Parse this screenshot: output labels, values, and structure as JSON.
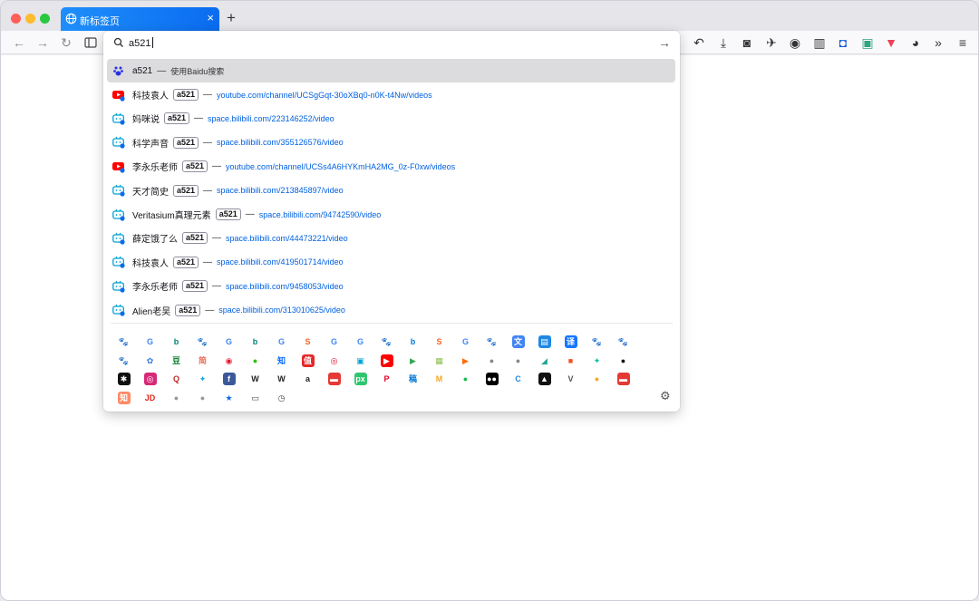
{
  "tab": {
    "title": "新标签页",
    "close": "×",
    "new_tab": "+"
  },
  "nav": {
    "back": "←",
    "forward": "→",
    "reload": "↻"
  },
  "urlbar": {
    "value": "a521",
    "go": "→"
  },
  "results": [
    {
      "icon": "baidu-icon",
      "title": "a521",
      "hint": "使用Baidu搜索",
      "selected": true
    },
    {
      "icon": "youtube-icon",
      "title": "科技袁人",
      "keyword": "a521",
      "url": "youtube.com/channel/UCSgGqt-30oXBq0-n0K-t4Nw/videos"
    },
    {
      "icon": "bilibili-icon",
      "title": "妈咪说",
      "keyword": "a521",
      "url": "space.bilibili.com/223146252/video"
    },
    {
      "icon": "bilibili-icon",
      "title": "科学声音",
      "keyword": "a521",
      "url": "space.bilibili.com/355126576/video"
    },
    {
      "icon": "youtube-icon",
      "title": "李永乐老师",
      "keyword": "a521",
      "url": "youtube.com/channel/UCSs4A6HYKmHA2MG_0z-F0xw/videos"
    },
    {
      "icon": "bilibili-icon",
      "title": "天才简史",
      "keyword": "a521",
      "url": "space.bilibili.com/213845897/video"
    },
    {
      "icon": "bilibili-icon",
      "title": "Veritasium真理元素",
      "keyword": "a521",
      "url": "space.bilibili.com/94742590/video"
    },
    {
      "icon": "bilibili-icon",
      "title": "薛定饿了么",
      "keyword": "a521",
      "url": "space.bilibili.com/44473221/video"
    },
    {
      "icon": "bilibili-icon",
      "title": "科技袁人",
      "keyword": "a521",
      "url": "space.bilibili.com/419501714/video"
    },
    {
      "icon": "bilibili-icon",
      "title": "李永乐老师",
      "keyword": "a521",
      "url": "space.bilibili.com/9458053/video"
    },
    {
      "icon": "bilibili-icon",
      "title": "Alien老吴",
      "keyword": "a521",
      "url": "space.bilibili.com/313010625/video"
    }
  ],
  "engine_rows": [
    [
      {
        "name": "baidu-icon",
        "glyph": "🐾",
        "bg": "#ffffff",
        "fg": "#2932e1"
      },
      {
        "name": "google-icon",
        "glyph": "G",
        "bg": "#ffffff",
        "fg": "#4285f4"
      },
      {
        "name": "bing-icon",
        "glyph": "b",
        "bg": "#ffffff",
        "fg": "#008373"
      },
      {
        "name": "baidu-icon",
        "glyph": "🐾",
        "bg": "#ffffff",
        "fg": "#2932e1"
      },
      {
        "name": "google-icon",
        "glyph": "G",
        "bg": "#ffffff",
        "fg": "#4285f4"
      },
      {
        "name": "bing-icon",
        "glyph": "b",
        "bg": "#ffffff",
        "fg": "#008373"
      },
      {
        "name": "google-icon",
        "glyph": "G",
        "bg": "#ffffff",
        "fg": "#4285f4"
      },
      {
        "name": "sogou-icon",
        "glyph": "S",
        "bg": "#ffffff",
        "fg": "#fb6022"
      },
      {
        "name": "google-icon",
        "glyph": "G",
        "bg": "#ffffff",
        "fg": "#4285f4"
      },
      {
        "name": "google-icon",
        "glyph": "G",
        "bg": "#ffffff",
        "fg": "#4285f4"
      },
      {
        "name": "baidu-icon",
        "glyph": "🐾",
        "bg": "#ffffff",
        "fg": "#2932e1"
      },
      {
        "name": "bing-icon",
        "glyph": "b",
        "bg": "#ffffff",
        "fg": "#0078d7"
      },
      {
        "name": "sogou-icon",
        "glyph": "S",
        "bg": "#ffffff",
        "fg": "#fb6022"
      },
      {
        "name": "google-icon",
        "glyph": "G",
        "bg": "#ffffff",
        "fg": "#4285f4"
      },
      {
        "name": "baidu-icon",
        "glyph": "🐾",
        "bg": "#ffffff",
        "fg": "#2932e1"
      },
      {
        "name": "translate-icon",
        "glyph": "文",
        "bg": "#4285f4",
        "fg": "#ffffff"
      },
      {
        "name": "dictionary-icon",
        "glyph": "▤",
        "bg": "#1e88e5",
        "fg": "#ffffff"
      },
      {
        "name": "translate-cn-icon",
        "glyph": "译",
        "bg": "#1677ff",
        "fg": "#ffffff"
      },
      {
        "name": "baidu-icon",
        "glyph": "🐾",
        "bg": "#ffffff",
        "fg": "#2932e1"
      },
      {
        "name": "baidu-icon",
        "glyph": "🐾",
        "bg": "#ffffff",
        "fg": "#2932e1"
      }
    ],
    [
      {
        "name": "baidu-icon",
        "glyph": "🐾",
        "bg": "#ffffff",
        "fg": "#2932e1"
      },
      {
        "name": "fanyi-icon",
        "glyph": "✿",
        "bg": "#ffffff",
        "fg": "#3b7ddd"
      },
      {
        "name": "douban-icon",
        "glyph": "豆",
        "bg": "#ffffff",
        "fg": "#007722"
      },
      {
        "name": "jianshu-icon",
        "glyph": "简",
        "bg": "#ffffff",
        "fg": "#ea6f5a"
      },
      {
        "name": "weibo-icon",
        "glyph": "◉",
        "bg": "#ffffff",
        "fg": "#e6162d"
      },
      {
        "name": "wechat-icon",
        "glyph": "●",
        "bg": "#ffffff",
        "fg": "#2dc100"
      },
      {
        "name": "zhihu-icon",
        "glyph": "知",
        "bg": "#ffffff",
        "fg": "#0066ff"
      },
      {
        "name": "smzdm-icon",
        "glyph": "值",
        "bg": "#e62828",
        "fg": "#ffffff"
      },
      {
        "name": "netease-music-icon",
        "glyph": "◎",
        "bg": "#ffffff",
        "fg": "#e60026"
      },
      {
        "name": "bilibili-icon",
        "glyph": "▣",
        "bg": "#ffffff",
        "fg": "#00a1d6"
      },
      {
        "name": "youtube-icon",
        "glyph": "▶",
        "bg": "#ff0000",
        "fg": "#ffffff"
      },
      {
        "name": "play-icon",
        "glyph": "▶",
        "bg": "#ffffff",
        "fg": "#34a853"
      },
      {
        "name": "map-icon",
        "glyph": "▦",
        "bg": "#ffffff",
        "fg": "#8bc34a"
      },
      {
        "name": "tencent-video-icon",
        "glyph": "▶",
        "bg": "#ffffff",
        "fg": "#ff6a00"
      },
      {
        "name": "search-icon",
        "glyph": "●",
        "bg": "#ffffff",
        "fg": "#888888"
      },
      {
        "name": "search-icon",
        "glyph": "●",
        "bg": "#ffffff",
        "fg": "#888888"
      },
      {
        "name": "pattern-icon",
        "glyph": "◢",
        "bg": "#ffffff",
        "fg": "#26a69a"
      },
      {
        "name": "microsoft-icon",
        "glyph": "■",
        "bg": "#ffffff",
        "fg": "#f25022"
      },
      {
        "name": "feiyu-icon",
        "glyph": "✦",
        "bg": "#ffffff",
        "fg": "#00bfa5"
      },
      {
        "name": "github-icon",
        "glyph": "●",
        "bg": "#ffffff",
        "fg": "#111111"
      }
    ],
    [
      {
        "name": "wolfram-icon",
        "glyph": "✱",
        "bg": "#111111",
        "fg": "#ffffff"
      },
      {
        "name": "instagram-icon",
        "glyph": "◎",
        "bg": "#d62976",
        "fg": "#ffffff"
      },
      {
        "name": "quora-icon",
        "glyph": "Q",
        "bg": "#ffffff",
        "fg": "#b92b27"
      },
      {
        "name": "twitter-icon",
        "glyph": "✦",
        "bg": "#ffffff",
        "fg": "#1da1f2"
      },
      {
        "name": "facebook-icon",
        "glyph": "f",
        "bg": "#3b5998",
        "fg": "#ffffff"
      },
      {
        "name": "wikipedia-icon",
        "glyph": "W",
        "bg": "#ffffff",
        "fg": "#222222"
      },
      {
        "name": "wikipedia-icon",
        "glyph": "W",
        "bg": "#ffffff",
        "fg": "#222222"
      },
      {
        "name": "amazon-icon",
        "glyph": "a",
        "bg": "#ffffff",
        "fg": "#222222"
      },
      {
        "name": "pixabay-red-icon",
        "glyph": "▬",
        "bg": "#e53935",
        "fg": "#ffffff"
      },
      {
        "name": "pixabay-icon",
        "glyph": "px",
        "bg": "#2ec66d",
        "fg": "#ffffff"
      },
      {
        "name": "pinterest-icon",
        "glyph": "P",
        "bg": "#ffffff",
        "fg": "#e60023"
      },
      {
        "name": "stock-icon",
        "glyph": "稿",
        "bg": "#ffffff",
        "fg": "#0078d7"
      },
      {
        "name": "mosaic-icon",
        "glyph": "M",
        "bg": "#ffffff",
        "fg": "#f5a623"
      },
      {
        "name": "spotify-icon",
        "glyph": "●",
        "bg": "#ffffff",
        "fg": "#1db954"
      },
      {
        "name": "medium-icon",
        "glyph": "●●",
        "bg": "#000000",
        "fg": "#ffffff"
      },
      {
        "name": "ccleaner-icon",
        "glyph": "C",
        "bg": "#ffffff",
        "fg": "#1e88e5"
      },
      {
        "name": "unsplash-icon",
        "glyph": "▲",
        "bg": "#111111",
        "fg": "#ffffff"
      },
      {
        "name": "vector-icon",
        "glyph": "V",
        "bg": "#ffffff",
        "fg": "#555555"
      },
      {
        "name": "shiba-icon",
        "glyph": "●",
        "bg": "#ffffff",
        "fg": "#f5a623"
      },
      {
        "name": "red-badge-icon",
        "glyph": "▬",
        "bg": "#e53935",
        "fg": "#ffffff"
      }
    ],
    [
      {
        "name": "zhihu-orange-icon",
        "glyph": "知",
        "bg": "#ff8a65",
        "fg": "#ffffff"
      },
      {
        "name": "jd-icon",
        "glyph": "JD",
        "bg": "#ffffff",
        "fg": "#e1251b"
      },
      {
        "name": "search-icon",
        "glyph": "●",
        "bg": "#ffffff",
        "fg": "#999999"
      },
      {
        "name": "search-icon",
        "glyph": "●",
        "bg": "#ffffff",
        "fg": "#999999"
      },
      {
        "name": "bookmarks-icon",
        "glyph": "★",
        "bg": "#ffffff",
        "fg": "#0a6cf0"
      },
      {
        "name": "tabs-icon",
        "glyph": "▭",
        "bg": "#ffffff",
        "fg": "#444444"
      },
      {
        "name": "history-icon",
        "glyph": "◷",
        "bg": "#ffffff",
        "fg": "#444444"
      }
    ]
  ],
  "toolbar_icons": [
    {
      "name": "undo-icon",
      "glyph": "↶"
    },
    {
      "name": "download-icon",
      "glyph": "⤓"
    },
    {
      "name": "screenshot-icon",
      "glyph": "◙"
    },
    {
      "name": "rocket-icon",
      "glyph": "✈"
    },
    {
      "name": "record-icon",
      "glyph": "◉"
    },
    {
      "name": "sidebar-icon",
      "glyph": "▥"
    },
    {
      "name": "bitwarden-icon",
      "glyph": "◘"
    },
    {
      "name": "save-icon",
      "glyph": "▣"
    },
    {
      "name": "pocket-icon",
      "glyph": "▼"
    },
    {
      "name": "panda-icon",
      "glyph": "◕"
    },
    {
      "name": "overflow-icon",
      "glyph": "»"
    },
    {
      "name": "menu-icon",
      "glyph": "≡"
    }
  ]
}
